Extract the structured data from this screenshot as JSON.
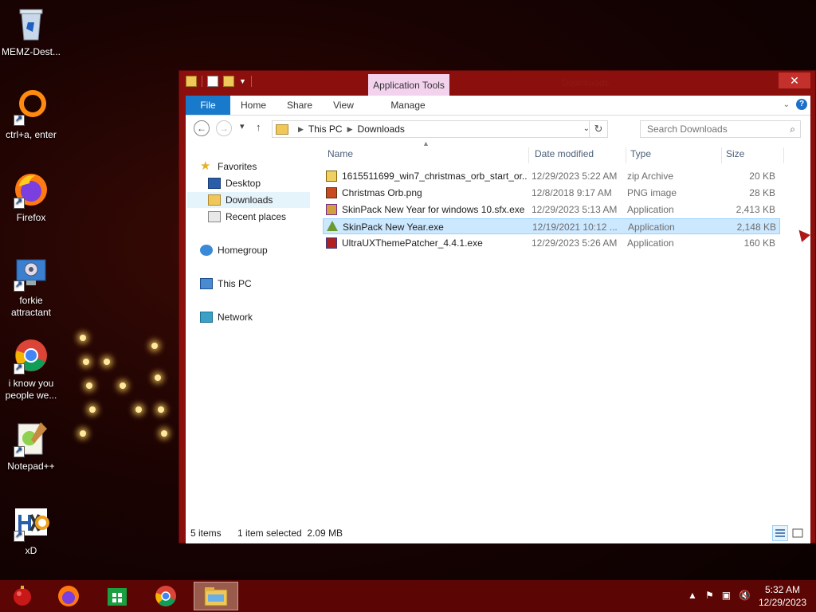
{
  "desktop": {
    "icons": [
      {
        "label": "MEMZ-Dest...",
        "icon": "recycle-bin-icon"
      },
      {
        "label": "ctrl+a, enter",
        "icon": "ring-icon"
      },
      {
        "label": "Firefox",
        "icon": "firefox-icon"
      },
      {
        "label": "forkie attractant",
        "icon": "computer-settings-icon"
      },
      {
        "label": "i know you people we...",
        "icon": "chrome-icon"
      },
      {
        "label": "Notepad++",
        "icon": "notepadpp-icon"
      },
      {
        "label": "xD",
        "icon": "hxd-icon"
      }
    ]
  },
  "window": {
    "title": "Downloads",
    "context_tab": "Application Tools",
    "ribbon_tabs": [
      "File",
      "Home",
      "Share",
      "View",
      "Manage"
    ],
    "close_label": "✕",
    "address": {
      "segments": [
        "This PC",
        "Downloads"
      ]
    },
    "search": {
      "placeholder": "Search Downloads"
    },
    "nav": {
      "favorites": "Favorites",
      "desktop": "Desktop",
      "downloads": "Downloads",
      "recent": "Recent places",
      "homegroup": "Homegroup",
      "thispc": "This PC",
      "network": "Network"
    },
    "columns": {
      "name": "Name",
      "date": "Date modified",
      "type": "Type",
      "size": "Size"
    },
    "files": [
      {
        "name": "1615511699_win7_christmas_orb_start_or...",
        "date": "12/29/2023 5:22 AM",
        "type": "zip Archive",
        "size": "20 KB",
        "icon": "zip-icon"
      },
      {
        "name": "Christmas Orb.png",
        "date": "12/8/2018 9:17 AM",
        "type": "PNG image",
        "size": "28 KB",
        "icon": "image-icon"
      },
      {
        "name": "SkinPack New Year for windows 10.sfx.exe",
        "date": "12/29/2023 5:13 AM",
        "type": "Application",
        "size": "2,413 KB",
        "icon": "archive-exe-icon"
      },
      {
        "name": "SkinPack New Year.exe",
        "date": "12/19/2021 10:12 ...",
        "type": "Application",
        "size": "2,148 KB",
        "icon": "tree-exe-icon"
      },
      {
        "name": "UltraUXThemePatcher_4.4.1.exe",
        "date": "12/29/2023 5:26 AM",
        "type": "Application",
        "size": "160 KB",
        "icon": "patcher-exe-icon"
      }
    ],
    "status": {
      "count": "5 items",
      "selection": "1 item selected  2.09 MB"
    }
  },
  "taskbar": {
    "time": "5:32 AM",
    "date": "12/29/2023"
  },
  "colors": {
    "accent": "#1979ca",
    "window_frame": "#8b0f0d",
    "taskbar": "#5b0604",
    "selection": "#cce8ff"
  }
}
